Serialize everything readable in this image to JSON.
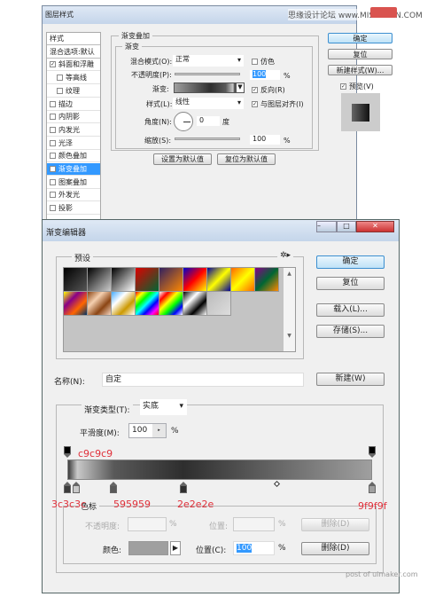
{
  "layer_style": {
    "title": "图层样式",
    "watermark": "思缘设计论坛  www.MISSYUAN.COM",
    "sidebar": [
      {
        "label": "样式",
        "checkbox": false,
        "checked": false
      },
      {
        "label": "混合选项:默认",
        "checkbox": false,
        "checked": false
      },
      {
        "label": "斜面和浮雕",
        "checkbox": true,
        "checked": true
      },
      {
        "label": "等高线",
        "checkbox": true,
        "checked": false,
        "indent": true
      },
      {
        "label": "纹理",
        "checkbox": true,
        "checked": false,
        "indent": true
      },
      {
        "label": "描边",
        "checkbox": true,
        "checked": false
      },
      {
        "label": "内阴影",
        "checkbox": true,
        "checked": false
      },
      {
        "label": "内发光",
        "checkbox": true,
        "checked": false
      },
      {
        "label": "光泽",
        "checkbox": true,
        "checked": false
      },
      {
        "label": "颜色叠加",
        "checkbox": true,
        "checked": false
      },
      {
        "label": "渐变叠加",
        "checkbox": true,
        "checked": true,
        "selected": true
      },
      {
        "label": "图案叠加",
        "checkbox": true,
        "checked": false
      },
      {
        "label": "外发光",
        "checkbox": true,
        "checked": false
      },
      {
        "label": "投影",
        "checkbox": true,
        "checked": false
      }
    ],
    "group_title": "渐变叠加",
    "sub_title": "渐变",
    "blend_mode_label": "混合模式(O):",
    "blend_mode": "正常",
    "dither_label": "仿色",
    "dither": false,
    "opacity_label": "不透明度(P):",
    "opacity": "100",
    "pct": "%",
    "gradient_label": "渐变:",
    "reverse_label": "反向(R)",
    "reverse": true,
    "style_label": "样式(L):",
    "style": "线性",
    "align_label": "与图层对齐(I)",
    "align": true,
    "angle_label": "角度(N):",
    "angle": "0",
    "angle_unit": "度",
    "scale_label": "缩放(S):",
    "scale": "100",
    "set_default": "设置为默认值",
    "reset_default": "复位为默认值",
    "ok": "确定",
    "reset": "复位",
    "new_style": "新建样式(W)...",
    "preview_label": "预览(V)",
    "preview": true
  },
  "gradient_editor": {
    "title": "渐变编辑器",
    "presets_label": "预设",
    "gear_icon": "gear-icon",
    "presets": [
      [
        "#000",
        "#555"
      ],
      [
        "#000",
        "#ccc"
      ],
      [
        "#000",
        "#fff"
      ],
      [
        "#d00",
        "#063"
      ],
      [
        "#302060",
        "#f80"
      ],
      [
        "#00c",
        "#f00",
        "#ff0"
      ],
      [
        "#009",
        "#ff0",
        "#009"
      ],
      [
        "#f60",
        "#ff0",
        "#f60"
      ],
      [
        "#808",
        "#063",
        "#f80"
      ],
      [
        "#ff0",
        "#808",
        "#f60",
        "#036"
      ],
      [
        "#8b4513",
        "#f5d0b0",
        "#8b4513",
        "#f5d5c0"
      ],
      [
        "#4af",
        "#fff",
        "#c90",
        "#fff"
      ],
      [
        "#f00",
        "#ff0",
        "#0f0",
        "#0ff",
        "#00f",
        "#f0f",
        "#f00"
      ],
      [
        "#fff",
        "#f00",
        "#ff0",
        "#0f0",
        "#00f",
        "#fff"
      ],
      [
        "#000",
        "#fff",
        "#000",
        "#fff"
      ],
      [
        "#bbb",
        "#ddd"
      ]
    ],
    "ok": "确定",
    "reset": "复位",
    "load": "载入(L)...",
    "save": "存储(S)...",
    "name_label": "名称(N):",
    "name": "自定",
    "new": "新建(W)",
    "type_label": "渐变类型(T):",
    "type": "实底",
    "smooth_label": "平滑度(M):",
    "smooth": "100",
    "pct": "%",
    "stops": [
      {
        "color": "#3c3c3c",
        "location": 0
      },
      {
        "color": "#c9c9c9",
        "location": 3
      },
      {
        "color": "#595959",
        "location": 15
      },
      {
        "color": "#2e2e2e",
        "location": 38
      },
      {
        "color": "#9f9f9f",
        "location": 100
      }
    ],
    "midpoint_location": 69,
    "annotations": {
      "a": "c9c9c9",
      "b": "3c3c3c",
      "c": "595959",
      "d": "2e2e2e",
      "e": "9f9f9f"
    },
    "stops_group": "色标",
    "opacity_label": "不透明度:",
    "location_label": "位置:",
    "delete": "删除(D)",
    "color_label": "颜色:",
    "selected_color": "#9f9f9f",
    "color_location_label": "位置(C):",
    "color_location": "100",
    "watermark": "post of uimaker.com"
  }
}
